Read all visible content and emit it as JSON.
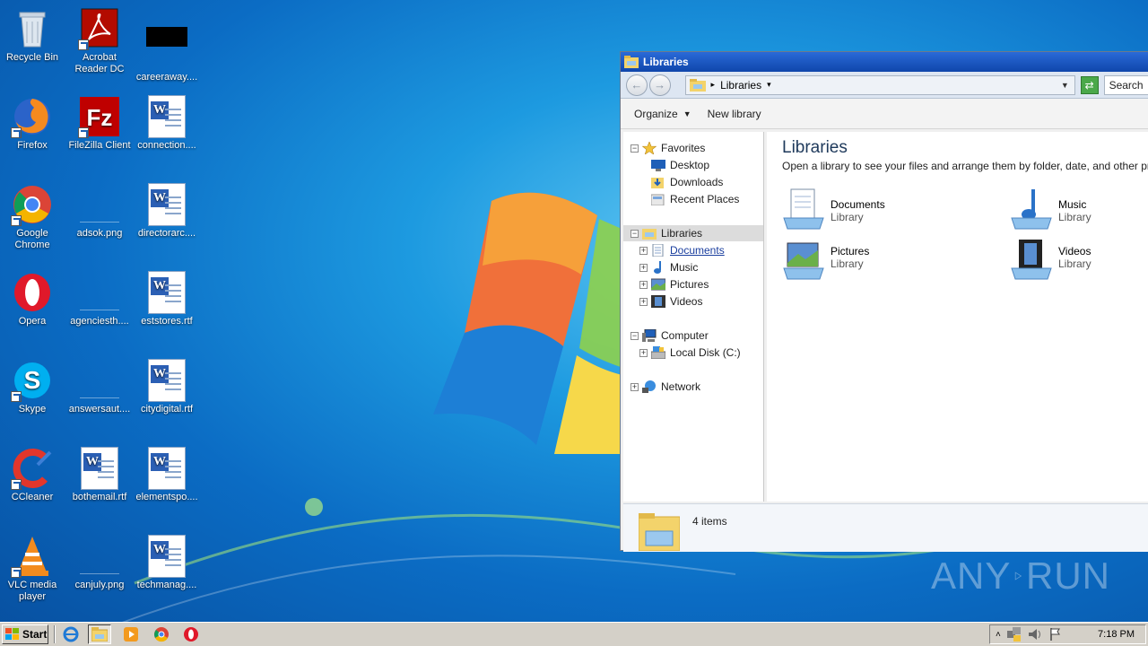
{
  "desktop": {
    "icons": [
      {
        "label": "Recycle Bin",
        "icon": "recycle-bin-icon"
      },
      {
        "label": "Acrobat Reader DC",
        "icon": "acrobat-icon"
      },
      {
        "label": "careeraway....",
        "icon": "black-file-icon"
      },
      {
        "label": "Firefox",
        "icon": "firefox-icon"
      },
      {
        "label": "FileZilla Client",
        "icon": "filezilla-icon"
      },
      {
        "label": "connection....",
        "icon": "word-doc-icon"
      },
      {
        "label": "Google Chrome",
        "icon": "chrome-icon"
      },
      {
        "label": "adsok.png",
        "icon": "png-file-icon"
      },
      {
        "label": "directorarc....",
        "icon": "word-doc-icon"
      },
      {
        "label": "Opera",
        "icon": "opera-icon"
      },
      {
        "label": "agenciesth....",
        "icon": "png-file-icon"
      },
      {
        "label": "eststores.rtf",
        "icon": "word-doc-icon"
      },
      {
        "label": "Skype",
        "icon": "skype-icon"
      },
      {
        "label": "answersaut....",
        "icon": "png-file-icon"
      },
      {
        "label": "citydigital.rtf",
        "icon": "word-doc-icon"
      },
      {
        "label": "CCleaner",
        "icon": "ccleaner-icon"
      },
      {
        "label": "bothemail.rtf",
        "icon": "word-doc-icon"
      },
      {
        "label": "elementspo....",
        "icon": "word-doc-icon"
      },
      {
        "label": "VLC media player",
        "icon": "vlc-icon"
      },
      {
        "label": "canjuly.png",
        "icon": "png-file-icon"
      },
      {
        "label": "techmanag....",
        "icon": "word-doc-icon"
      }
    ]
  },
  "explorer": {
    "title": "Libraries",
    "address": {
      "crumb": "Libraries",
      "search_placeholder": "Search"
    },
    "commands": {
      "organize": "Organize",
      "new_library": "New library"
    },
    "nav": {
      "favorites": "Favorites",
      "desktop": "Desktop",
      "downloads": "Downloads",
      "recent_places": "Recent Places",
      "libraries": "Libraries",
      "documents": "Documents",
      "music": "Music",
      "pictures": "Pictures",
      "videos": "Videos",
      "computer": "Computer",
      "local_disk": "Local Disk (C:)",
      "network": "Network"
    },
    "content": {
      "heading": "Libraries",
      "subtitle": "Open a library to see your files and arrange them by folder, date, and other properties.",
      "items": [
        {
          "name": "Documents",
          "type": "Library"
        },
        {
          "name": "Music",
          "type": "Library"
        },
        {
          "name": "Pictures",
          "type": "Library"
        },
        {
          "name": "Videos",
          "type": "Library"
        }
      ]
    },
    "status": {
      "count": "4 items"
    }
  },
  "taskbar": {
    "start_label": "Start",
    "clock": "7:18 PM"
  },
  "watermark": {
    "text_left": "ANY",
    "text_right": "RUN"
  }
}
